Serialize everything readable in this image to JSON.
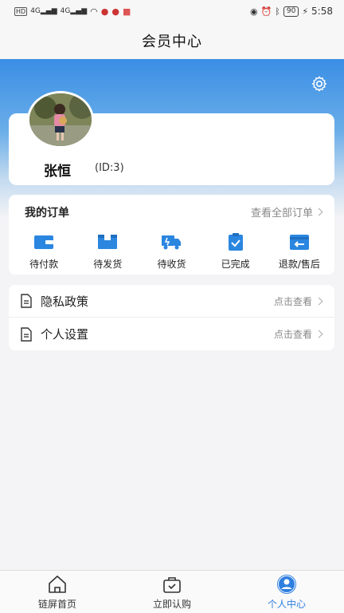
{
  "status_bar": {
    "left_chips": "HD",
    "signal_label_1": "4G",
    "signal_label_2": "4G",
    "battery": "90",
    "time": "5:58"
  },
  "nav": {
    "title": "会员中心"
  },
  "profile": {
    "name": "张恒",
    "id_label": "(ID:3)"
  },
  "orders": {
    "title": "我的订单",
    "view_all_label": "查看全部订单",
    "items": [
      {
        "label": "待付款",
        "icon": "wallet-icon"
      },
      {
        "label": "待发货",
        "icon": "box-icon"
      },
      {
        "label": "待收货",
        "icon": "truck-icon"
      },
      {
        "label": "已完成",
        "icon": "clipboard-check-icon"
      },
      {
        "label": "退款/售后",
        "icon": "refund-icon"
      }
    ]
  },
  "menu": [
    {
      "label": "隐私政策",
      "action": "点击查看",
      "icon": "document-icon"
    },
    {
      "label": "个人设置",
      "action": "点击查看",
      "icon": "document-icon"
    }
  ],
  "tabs": [
    {
      "label": "链屏首页",
      "icon": "home-icon",
      "active": false
    },
    {
      "label": "立即认购",
      "icon": "shopping-bag-icon",
      "active": false
    },
    {
      "label": "个人中心",
      "icon": "user-circle-icon",
      "active": true
    }
  ],
  "colors": {
    "accent": "#2f7fe0",
    "icon_blue": "#2b86e0",
    "hero_top": "#3a8ee6"
  }
}
